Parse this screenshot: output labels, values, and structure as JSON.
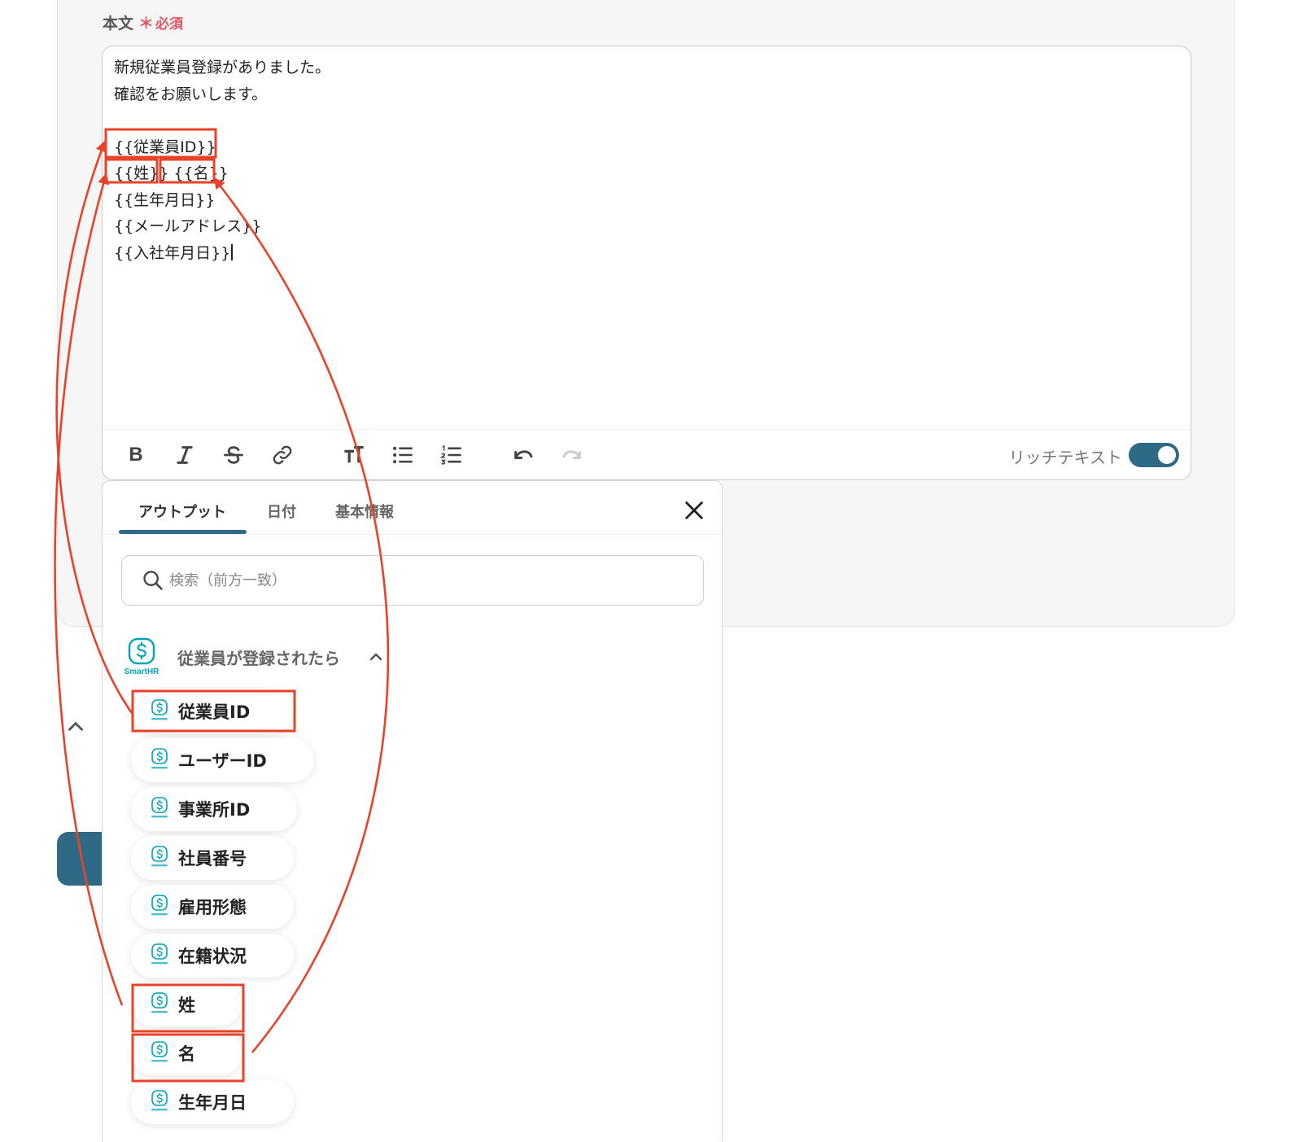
{
  "field": {
    "label": "本文",
    "required_star": "＊",
    "required_text": "必須"
  },
  "editor": {
    "lines": [
      "新規従業員登録がありました。",
      "確認をお願いします。",
      "",
      "{{従業員ID}}",
      "{{姓}} {{名}}",
      "{{生年月日}}",
      "{{メールアドレス}}",
      "{{入社年月日}}"
    ],
    "toolbar": {
      "bold_label": "B",
      "rich_text_label": "リッチテキスト",
      "rich_text_enabled": true
    }
  },
  "popup": {
    "tabs": [
      {
        "label": "アウトプット",
        "active": true
      },
      {
        "label": "日付",
        "active": false
      },
      {
        "label": "基本情報",
        "active": false
      }
    ],
    "search": {
      "placeholder": "検索（前方一致）",
      "value": ""
    },
    "group": {
      "title": "従業員が登録されたら",
      "logo_caption": "SmartHR",
      "expanded": true
    },
    "items": [
      {
        "label": "従業員ID",
        "highlighted": true
      },
      {
        "label": "ユーザーID",
        "highlighted": false
      },
      {
        "label": "事業所ID",
        "highlighted": false
      },
      {
        "label": "社員番号",
        "highlighted": false
      },
      {
        "label": "雇用形態",
        "highlighted": false
      },
      {
        "label": "在籍状況",
        "highlighted": false
      },
      {
        "label": "姓",
        "highlighted": true
      },
      {
        "label": "名",
        "highlighted": true
      },
      {
        "label": "生年月日",
        "highlighted": false
      }
    ]
  },
  "colors": {
    "accent": "#2e6a86",
    "annotation": "#e8432a",
    "smarthr": "#00a4b7",
    "required": "#e25563"
  }
}
